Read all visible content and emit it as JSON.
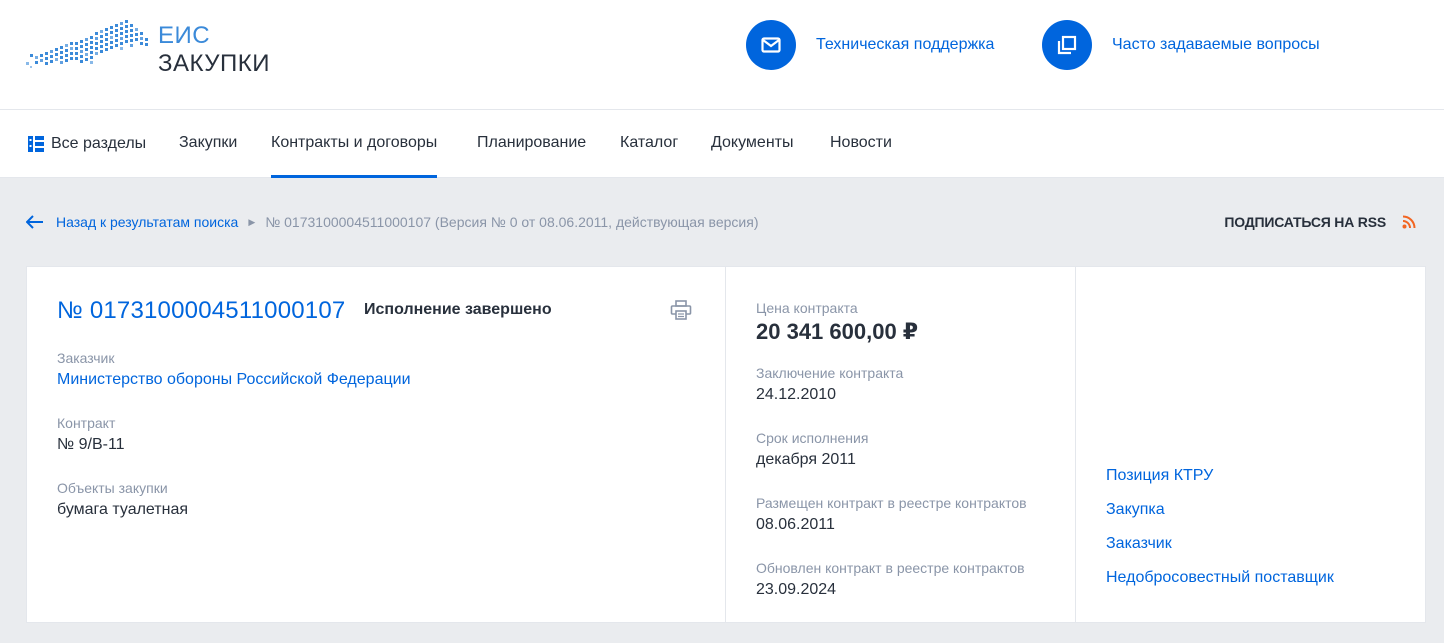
{
  "header": {
    "logo_line1": "ЕИС",
    "logo_line2": "ЗАКУПКИ",
    "support_label": "Техническая поддержка",
    "faq_label": "Часто задаваемые вопросы",
    "accent_color": "#0065dd"
  },
  "nav": {
    "items": [
      {
        "label": "Все разделы",
        "icon": "sections-icon"
      },
      {
        "label": "Закупки"
      },
      {
        "label": "Контракты и договоры",
        "active": true
      },
      {
        "label": "Планирование"
      },
      {
        "label": "Каталог"
      },
      {
        "label": "Документы"
      },
      {
        "label": "Новости"
      }
    ]
  },
  "breadcrumb": {
    "back_label": "Назад к результатам поиска",
    "current": "№ 0173100004511000107 (Версия № 0 от 08.06.2011, действующая версия)",
    "rss_label": "ПОДПИСАТЬСЯ НА RSS"
  },
  "contract": {
    "number": "№ 0173100004511000107",
    "status": "Исполнение завершено",
    "customer_label": "Заказчик",
    "customer_value": "Министерство обороны Российской Федерации",
    "contract_label": "Контракт",
    "contract_value": "№ 9/В-11",
    "objects_label": "Объекты закупки",
    "objects_value": "бумага туалетная"
  },
  "details": {
    "price_label": "Цена контракта",
    "price_value": "20 341 600,00 ₽",
    "conclusion_label": "Заключение контракта",
    "conclusion_value": "24.12.2010",
    "term_label": "Срок исполнения",
    "term_value": "декабря 2011",
    "placed_label": "Размещен контракт в реестре контрактов",
    "placed_value": "08.06.2011",
    "updated_label": "Обновлен контракт в реестре контрактов",
    "updated_value": "23.09.2024"
  },
  "side_links": [
    "Позиция КТРУ",
    "Закупка",
    "Заказчик",
    "Недобросовестный поставщик"
  ]
}
